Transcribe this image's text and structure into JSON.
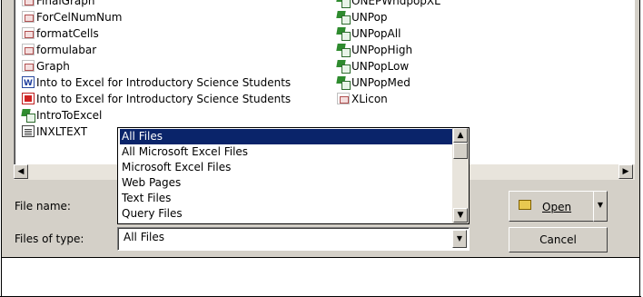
{
  "files_col1": [
    {
      "name": "FinalGraph",
      "icon": "excel-doc-icon"
    },
    {
      "name": "ForCelNumNum",
      "icon": "excel-doc-icon"
    },
    {
      "name": "formatCells",
      "icon": "excel-doc-icon"
    },
    {
      "name": "formulabar",
      "icon": "excel-doc-icon"
    },
    {
      "name": "Graph",
      "icon": "excel-doc-icon"
    },
    {
      "name": "Into to Excel for Introductory Science Students",
      "icon": "word-doc-icon"
    },
    {
      "name": "Into to Excel for Introductory Science Students",
      "icon": "pdf-doc-icon"
    },
    {
      "name": "IntroToExcel",
      "icon": "excel-workbook-icon"
    },
    {
      "name": "INXLTEXT",
      "icon": "text-file-icon"
    }
  ],
  "files_col2": [
    {
      "name": "ONEPWndpopXL",
      "icon": "excel-workbook-icon"
    },
    {
      "name": "UNPop",
      "icon": "excel-workbook-icon"
    },
    {
      "name": "UNPopAll",
      "icon": "excel-workbook-icon"
    },
    {
      "name": "UNPopHigh",
      "icon": "excel-workbook-icon"
    },
    {
      "name": "UNPopLow",
      "icon": "excel-workbook-icon"
    },
    {
      "name": "UNPopMed",
      "icon": "excel-workbook-icon"
    },
    {
      "name": "XLicon",
      "icon": "excel-doc-icon"
    }
  ],
  "file_name_label": "File name:",
  "file_type_label": "Files of type:",
  "file_type_value": "All Files",
  "file_type_options": [
    "All Files",
    "All Microsoft Excel Files",
    "Microsoft Excel Files",
    "Web Pages",
    "Text Files",
    "Query Files"
  ],
  "open_label": "Open",
  "cancel_label": "Cancel",
  "colors": {
    "selection": "#0a246a",
    "dialog_face": "#d4d0c8"
  }
}
